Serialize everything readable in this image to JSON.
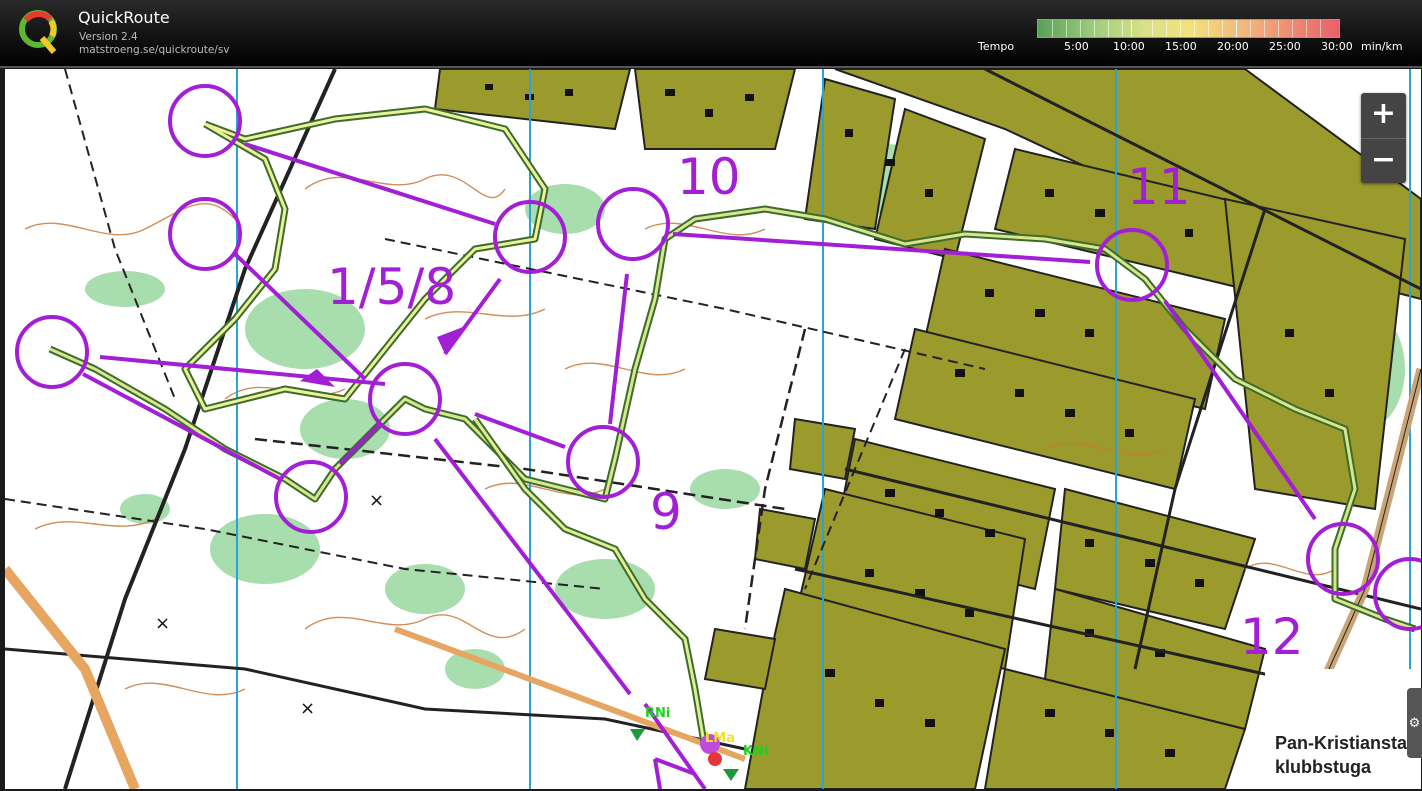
{
  "app": {
    "title": "QuickRoute",
    "version": "Version 2.4",
    "url": "matstroeng.se/quickroute/sv"
  },
  "legend": {
    "label": "Tempo",
    "ticks": [
      "5:00",
      "10:00",
      "15:00",
      "20:00",
      "25:00",
      "30:00"
    ],
    "unit": "min/km"
  },
  "zoom": {
    "in_label": "+",
    "out_label": "−"
  },
  "map": {
    "controls": [
      {
        "label": "1/5/8"
      },
      {
        "label": "9"
      },
      {
        "label": "10"
      },
      {
        "label": "11"
      },
      {
        "label": "12"
      }
    ],
    "text_labels": {
      "clubhouse_line1": "Pan-Kristiansta",
      "clubhouse_line2": "klubbstuga",
      "runner1": "RNi",
      "runner2": "KNi",
      "runner3": "LMa"
    }
  },
  "colors": {
    "course": "#a21fd6",
    "forest": "#7fcf88",
    "building_area": "#9b9a2c",
    "contour": "#c97a3a",
    "magnetic_north": "#2aa3d6"
  },
  "icons": [
    "quickroute-logo",
    "gear-icon"
  ]
}
